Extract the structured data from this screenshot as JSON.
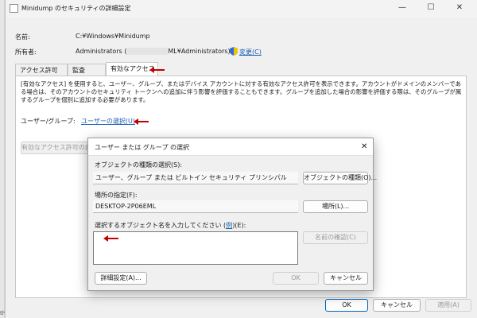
{
  "background": {
    "fragment_text": "ther"
  },
  "window": {
    "title": "Minidump のセキュリティの詳細設定",
    "controls": {
      "minimize": "—",
      "maximize": "☐",
      "close": "✕"
    }
  },
  "name_row": {
    "label": "名前:",
    "value": "C:¥Windows¥Minidump"
  },
  "owner_row": {
    "label": "所有者:",
    "value_prefix": "Administrators (",
    "value_suffix": "ML¥Administrators)",
    "change_link": "変更(C)"
  },
  "tabs": [
    {
      "label": "アクセス許可"
    },
    {
      "label": "監査"
    },
    {
      "label": "有効なアクセス"
    }
  ],
  "panel": {
    "description": "[有効なアクセス] を使用すると、ユーザー、グループ、またはデバイス アカウントに対する有効なアクセス許可を表示できます。アカウントがドメインのメンバーである場合は、そのアカウントのセキュリティ トークンへの追加に伴う影響を評価することもできます。グループを追加した場合の影響を評価する際は、そのグループが属するグループを個別に追加する必要があります。",
    "user_group_label": "ユーザー/グループ:",
    "select_user_link": "ユーザーの選択(U)",
    "view_effective_button": "有効なアクセス許可の表"
  },
  "footer": {
    "ok": "OK",
    "cancel": "キャンセル",
    "apply": "適用(A)"
  },
  "select_dialog": {
    "title": "ユーザー または グループ の選択",
    "object_type_label": "オブジェクトの種類の選択(S):",
    "object_type_value": "ユーザー、グループ または ビルトイン セキュリティ プリンシパル",
    "object_type_button": "オブジェクトの種類(O)...",
    "location_label": "場所の指定(F):",
    "location_value": "DESKTOP-2P06EML",
    "location_button": "場所(L)...",
    "name_label_prefix": "選択するオブジェクト名を入力してください (",
    "name_label_link": "例",
    "name_label_suffix": ")(E):",
    "name_input_value": "",
    "check_names_button": "名前の確認(C)",
    "advanced_button": "詳細設定(A)...",
    "ok_button": "OK",
    "cancel_button": "キャンセル",
    "close": "✕"
  },
  "colors": {
    "annotation_arrow": "#c40000",
    "link": "#1a5fb4",
    "accent": "#0067c0"
  }
}
